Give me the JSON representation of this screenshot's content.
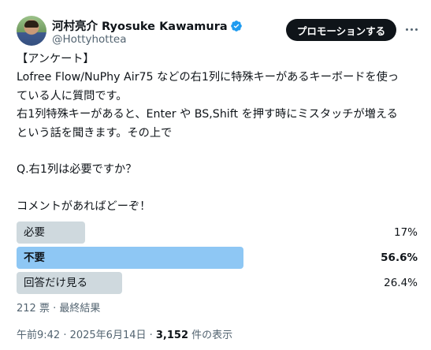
{
  "author": {
    "display_name": "河村亮介 Ryosuke Kawamura",
    "handle": "@Hottyhottea",
    "verified_icon": "verified-badge-icon",
    "accent": "#1d9bf0"
  },
  "header": {
    "promote_label": "プロモーションする",
    "more_icon": "more-options-icon"
  },
  "tweet": {
    "lines": [
      "【アンケート】",
      "Lofree Flow/NuPhy Air75 などの右1列に特殊キーがあるキーボードを使っ",
      "ている人に質問です。",
      "右1列特殊キーがあると、Enter や BS,Shift を押す時にミスタッチが増える",
      "という話を聞きます。その上で",
      "",
      "Q.右1列は必要ですか？",
      "",
      "コメントがあればどーぞ！"
    ]
  },
  "poll": {
    "options": [
      {
        "label": "必要",
        "percent": "17%",
        "share": 0.17,
        "winner": false
      },
      {
        "label": "不要",
        "percent": "56.6%",
        "share": 0.566,
        "winner": true
      },
      {
        "label": "回答だけ見る",
        "percent": "26.4%",
        "share": 0.264,
        "winner": false
      }
    ],
    "bar_color": "#cfd9de",
    "winner_color": "#8ec7f4",
    "meta": "212 票 · 最終結果"
  },
  "footer": {
    "time": "午前9:42 · 2025年6月14日 · ",
    "views_count": "3,152",
    "views_suffix": " 件の表示"
  }
}
